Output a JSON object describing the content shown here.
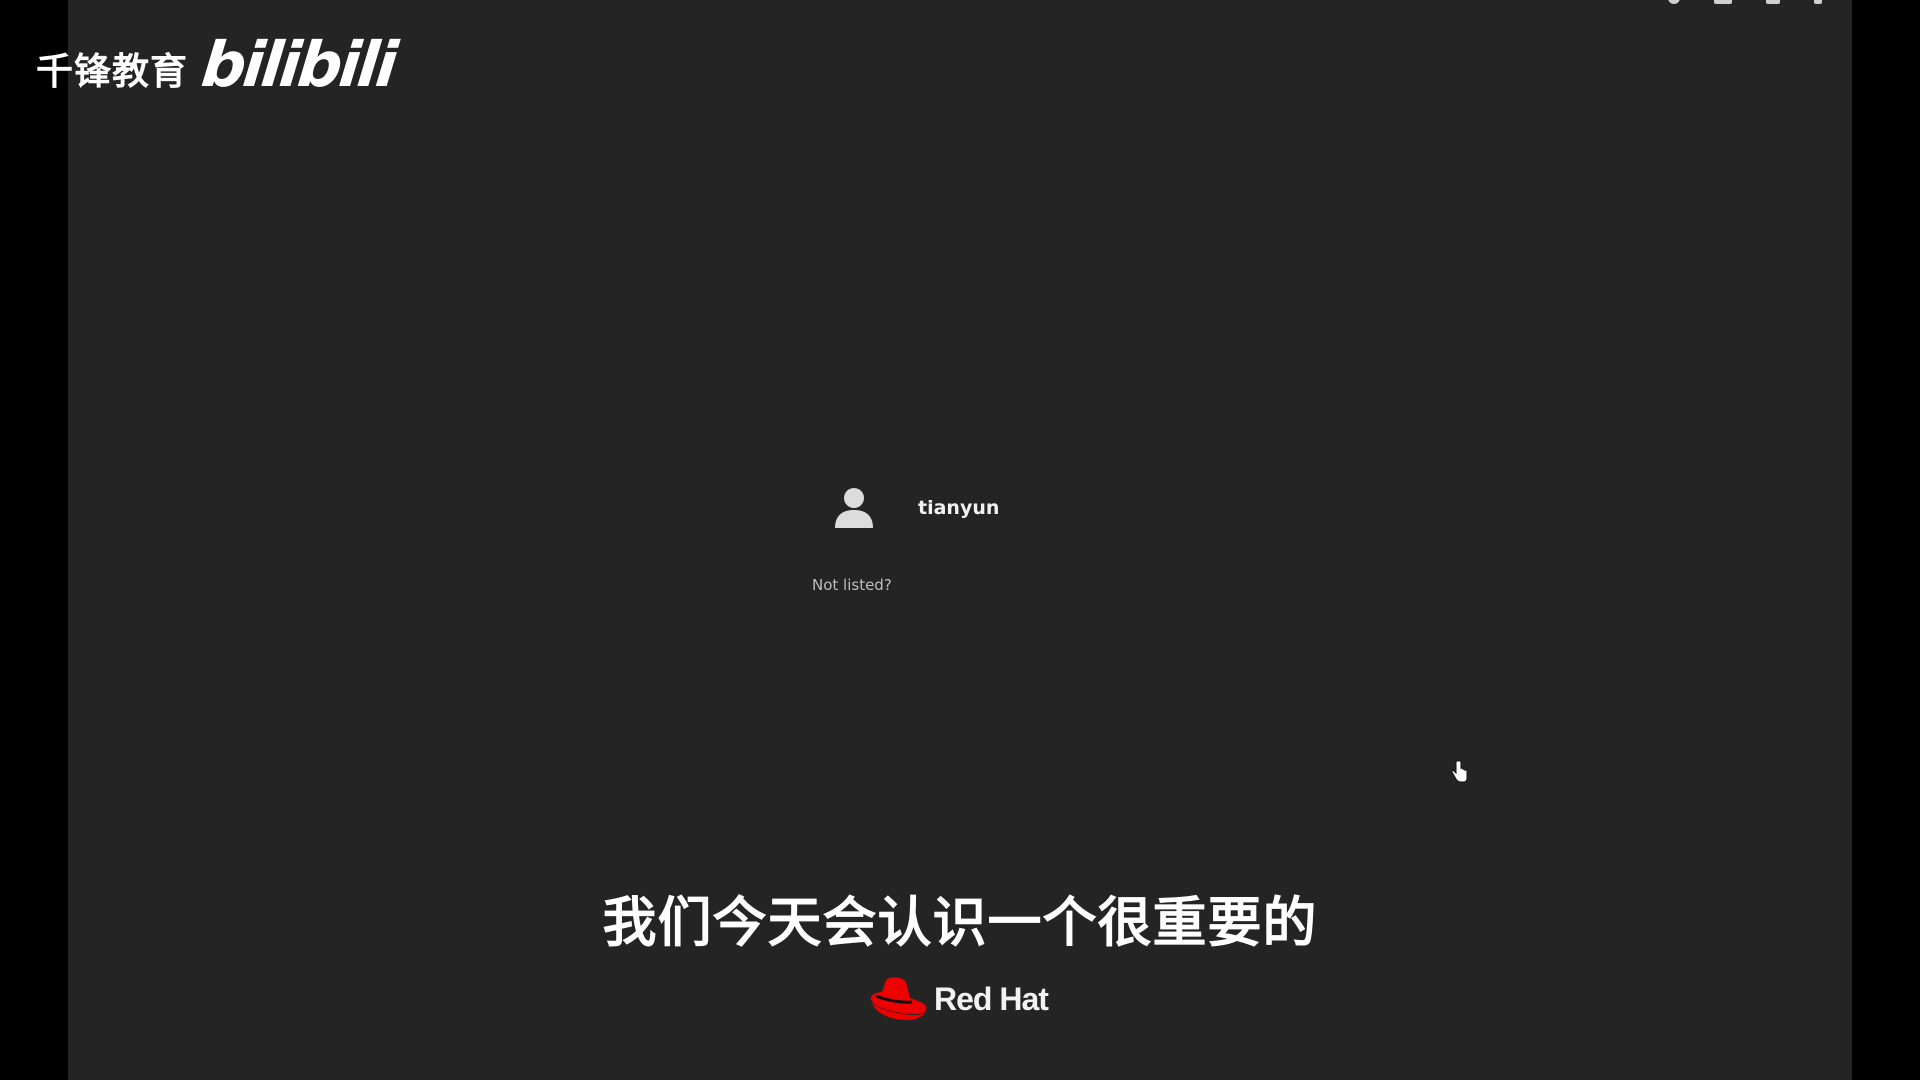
{
  "watermark": {
    "chinese_text": "千锋教育",
    "logo_text": "bilibili"
  },
  "login": {
    "users": [
      {
        "name": "tianyun",
        "icon": "user-avatar-icon"
      }
    ],
    "not_listed_label": "Not listed?"
  },
  "subtitle": {
    "text": "我们今天会认识一个很重要的"
  },
  "brand": {
    "text": "Red Hat",
    "icon": "redhat-logo-icon",
    "accent": "#ee0000"
  },
  "colors": {
    "background": "#242424",
    "frame": "#000000",
    "text": "#f2f2f2"
  }
}
